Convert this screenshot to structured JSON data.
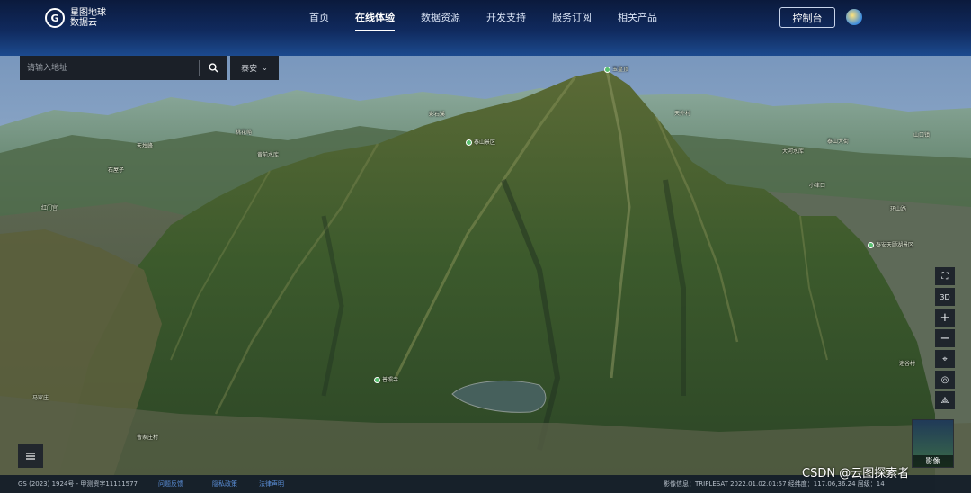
{
  "header": {
    "logo_line1": "星图地球",
    "logo_line2": "数据云",
    "nav": [
      {
        "label": "首页",
        "active": false
      },
      {
        "label": "在线体验",
        "active": true
      },
      {
        "label": "数据资源",
        "active": false
      },
      {
        "label": "开发支持",
        "active": false
      },
      {
        "label": "服务订阅",
        "active": false
      },
      {
        "label": "相关产品",
        "active": false
      }
    ],
    "console_label": "控制台"
  },
  "search": {
    "placeholder": "请输入地址",
    "city": "泰安"
  },
  "map_labels": {
    "summit": "玉皇顶",
    "scenic": "泰山景区",
    "temple": "普照寺",
    "reservoir_area": "彩石溪",
    "right_park": "泰安天颐湖景区",
    "village_left": "马家庄",
    "village_bottom": "曹家庄村",
    "village_right": "迷谷村",
    "left_items": [
      "天烛峰",
      "桃花峪",
      "黄前水库",
      "石屋子",
      "彩石溪",
      "红门宫"
    ],
    "right_items": [
      "天外村",
      "大河水库",
      "泰山大街",
      "小津口",
      "环山路",
      "山口镇"
    ]
  },
  "toolbar": {
    "tools": [
      {
        "icon": "fullscreen-icon",
        "glyph": "⛶"
      },
      {
        "icon": "3d-icon",
        "glyph": "3D"
      },
      {
        "icon": "zoom-in-icon",
        "glyph": "+"
      },
      {
        "icon": "zoom-out-icon",
        "glyph": "−"
      },
      {
        "icon": "location-pin-icon",
        "glyph": "⌖"
      },
      {
        "icon": "target-icon",
        "glyph": "◎"
      },
      {
        "icon": "compass-icon",
        "glyph": "⟁"
      }
    ],
    "layer_label": "影像"
  },
  "footer": {
    "copyright": "GS (2023) 1924号 - 甲测资字11111577",
    "links": [
      "问题反馈",
      "隐私政策",
      "法律声明"
    ],
    "info": "影像信息：TRIPLESAT 2022.01.02.01:57   经纬度：117.06,36.24   层级：14"
  },
  "watermark": "CSDN @云图探索者",
  "colors": {
    "header_top": "#0b1a3c",
    "header_bottom": "#1c4a8e",
    "panel_bg": "#1b2028",
    "poi_green": "#45b86a",
    "link_blue": "#5b8fd8"
  }
}
